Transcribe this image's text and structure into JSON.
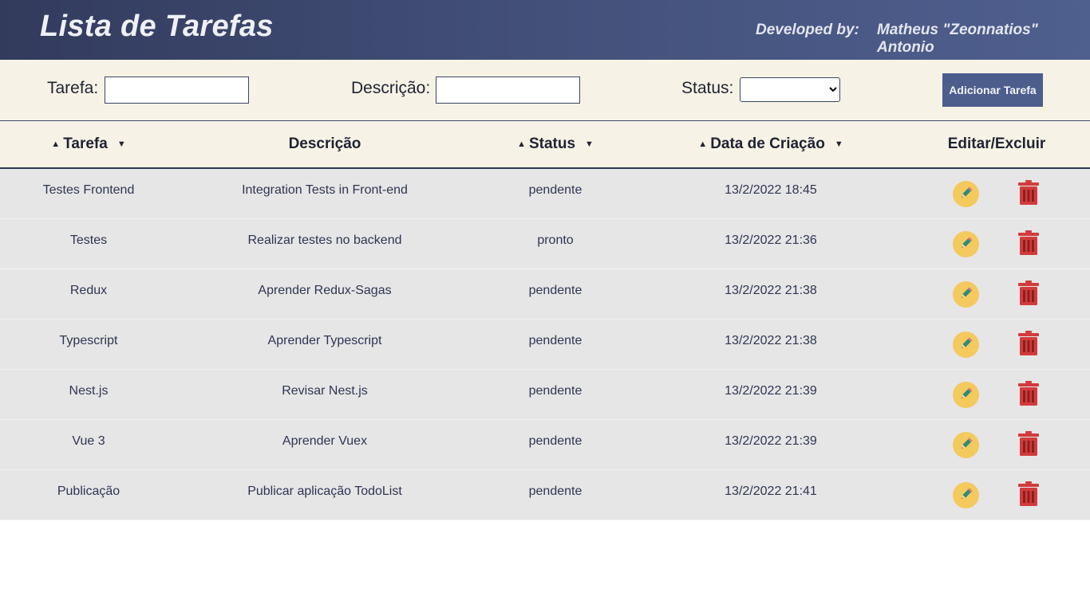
{
  "header": {
    "title": "Lista de Tarefas",
    "developed_by_label": "Developed by:",
    "developer_name": "Matheus \"Zeonnatios\" Antonio"
  },
  "form": {
    "task_label": "Tarefa:",
    "task_value": "",
    "description_label": "Descrição:",
    "description_value": "",
    "status_label": "Status:",
    "status_selected": "",
    "add_button_label": "Adicionar Tarefa"
  },
  "table": {
    "headers": {
      "task": "Tarefa",
      "description": "Descrição",
      "status": "Status",
      "created_at": "Data de Criação",
      "actions": "Editar/Excluir"
    },
    "sort_up_icon": "▲",
    "sort_down_icon": "▼",
    "rows": [
      {
        "task": "Testes Frontend",
        "description": "Integration Tests in Front-end",
        "status": "pendente",
        "created_at": "13/2/2022 18:45"
      },
      {
        "task": "Testes",
        "description": "Realizar testes no backend",
        "status": "pronto",
        "created_at": "13/2/2022 21:36"
      },
      {
        "task": "Redux",
        "description": "Aprender Redux-Sagas",
        "status": "pendente",
        "created_at": "13/2/2022 21:38"
      },
      {
        "task": "Typescript",
        "description": "Aprender Typescript",
        "status": "pendente",
        "created_at": "13/2/2022 21:38"
      },
      {
        "task": "Nest.js",
        "description": "Revisar Nest.js",
        "status": "pendente",
        "created_at": "13/2/2022 21:39"
      },
      {
        "task": "Vue 3",
        "description": "Aprender Vuex",
        "status": "pendente",
        "created_at": "13/2/2022 21:39"
      },
      {
        "task": "Publicação",
        "description": "Publicar aplicação TodoList",
        "status": "pendente",
        "created_at": "13/2/2022 21:41"
      }
    ]
  },
  "icons": {
    "edit": "pencil-icon",
    "delete": "trash-icon"
  },
  "colors": {
    "header_gradient_start": "#323b5c",
    "header_gradient_end": "#4f5f8e",
    "bar_background": "#f6f3e6",
    "row_background": "#e6e6e6",
    "button_background": "#4d5d8c",
    "edit_icon_background": "#f4c95d",
    "delete_icon_color": "#d23b3b"
  }
}
